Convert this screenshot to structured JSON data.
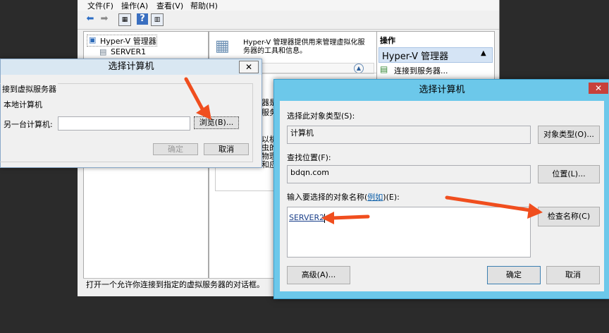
{
  "menu": [
    "文件(F)",
    "操作(A)",
    "查看(V)",
    "帮助(H)"
  ],
  "tree": {
    "root": "Hyper-V 管理器",
    "child": "SERVER1"
  },
  "center": {
    "intro": "Hyper-V 管理器提供用来管理虚拟化服务器的工具和信息。",
    "frag1": "器是",
    "frag2": "服务",
    "frag3": "以机",
    "frag4": "虫的",
    "frag5": "物理",
    "frag6": "和应"
  },
  "actions": {
    "header": "操作",
    "group": "Hyper-V 管理器",
    "connect": "连接到服务器..."
  },
  "status": "打开一个允许你连接到指定的虚拟服务器的对话框。",
  "dialog_left": {
    "title": "选择计算机",
    "group_label": "连接到虚拟服务器",
    "group_label_visible": "接到虚拟服务器",
    "local": "本地计算机",
    "other": "另一台计算机:",
    "browse": "浏览(B)...",
    "ok": "确定",
    "cancel": "取消"
  },
  "dialog_right": {
    "title": "选择计算机",
    "object_type_label": "选择此对象类型(S):",
    "object_type_value": "计算机",
    "object_type_button": "对象类型(O)...",
    "location_label": "查找位置(F):",
    "location_value": "bdqn.com",
    "location_button": "位置(L)...",
    "names_label_pre": "输入要选择的对象名称(",
    "names_label_link": "例如",
    "names_label_post": ")(E):",
    "names_value": "SERVER2",
    "check_button": "检查名称(C)",
    "advanced_button": "高级(A)...",
    "ok": "确定",
    "cancel": "取消"
  },
  "colors": {
    "arrow": "#f04e1e",
    "dialog_frame": "#6cc8ea"
  }
}
